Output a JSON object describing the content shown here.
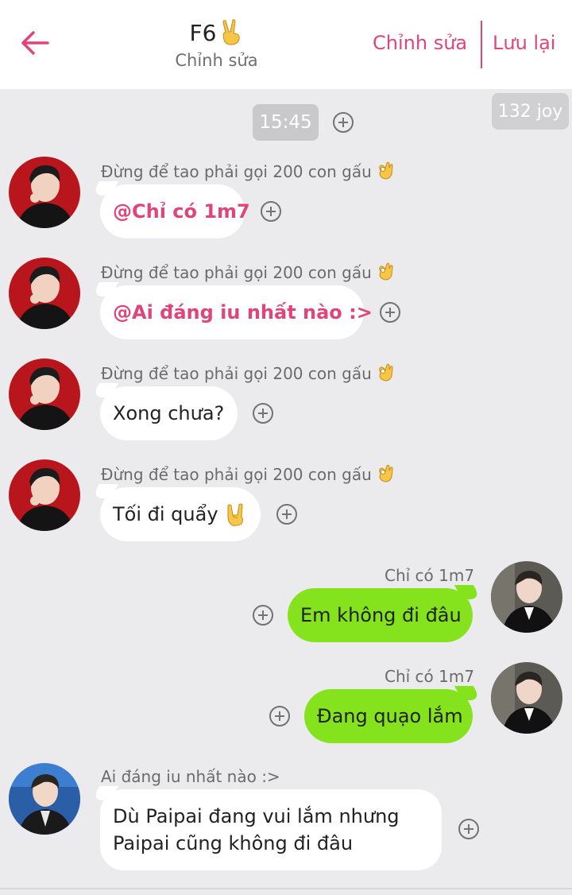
{
  "header": {
    "title": "F6",
    "title_emoji": "victory-hand",
    "subtitle": "Chỉnh sửa",
    "edit_label": "Chỉnh sửa",
    "save_label": "Lưu lại",
    "accent_color": "#e0457a"
  },
  "time_label": "15:45",
  "joy_badge": "132 joy",
  "messages": [
    {
      "side": "left",
      "sender": "Đừng để tao phải gọi 200 con gấu",
      "sender_emoji": "ok-hand",
      "text": "@Chỉ có 1m7",
      "style": "mention"
    },
    {
      "side": "left",
      "sender": "Đừng để tao phải gọi 200 con gấu",
      "sender_emoji": "ok-hand",
      "text": "@Ai đáng iu nhất nào :>",
      "style": "mention"
    },
    {
      "side": "left",
      "sender": "Đừng để tao phải gọi 200 con gấu",
      "sender_emoji": "ok-hand",
      "text": "Xong chưa?",
      "style": "normal"
    },
    {
      "side": "left",
      "sender": "Đừng để tao phải gọi 200 con gấu",
      "sender_emoji": "ok-hand",
      "text": "Tối đi quẩy",
      "text_emoji": "rock-hand",
      "style": "normal"
    },
    {
      "side": "right",
      "sender": "Chỉ có 1m7",
      "text": "Em không đi đâu",
      "style": "normal"
    },
    {
      "side": "right",
      "sender": "Chỉ có 1m7",
      "text": "Đang quạo lắm",
      "style": "normal"
    },
    {
      "side": "left",
      "sender": "Ai đáng iu nhất nào :>",
      "text_line1": "Dù Paipai đang vui lắm nhưng",
      "text_line2": "Paipai cũng không đi đâu",
      "style": "normal"
    }
  ],
  "colors": {
    "background": "#ebebed",
    "bubble_left": "#ffffff",
    "bubble_right": "#84e31c",
    "mention": "#e0457a"
  }
}
